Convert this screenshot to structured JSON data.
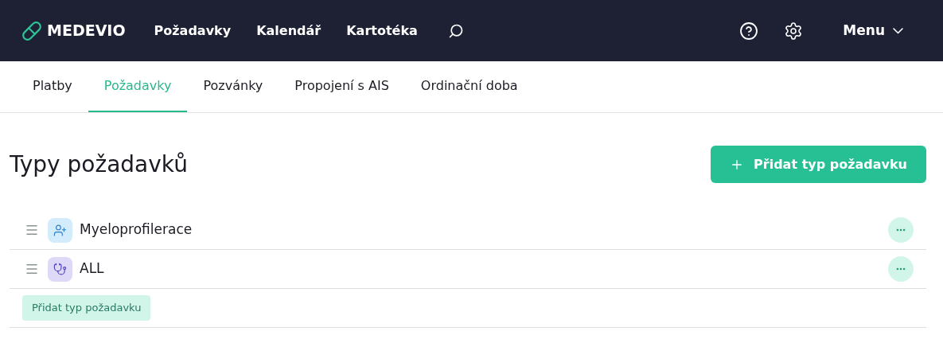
{
  "header": {
    "logo": "MEDEVIO",
    "nav": [
      {
        "label": "Požadavky"
      },
      {
        "label": "Kalendář"
      },
      {
        "label": "Kartotéka"
      }
    ],
    "menu": "Menu"
  },
  "tabs": [
    {
      "label": "Platby",
      "selected": false
    },
    {
      "label": "Požadavky",
      "selected": true
    },
    {
      "label": "Pozvánky",
      "selected": false
    },
    {
      "label": "Propojení s AIS",
      "selected": false
    },
    {
      "label": "Ordinační doba",
      "selected": false
    }
  ],
  "page": {
    "title": "Typy požadavků",
    "add_button": "Přidat typ požadavku"
  },
  "request_types": [
    {
      "name": "Myeloprofilerace",
      "kind": "person-add",
      "color": "#d3ecfb"
    },
    {
      "name": "ALL",
      "kind": "stethoscope",
      "color": "#ddd9f7"
    }
  ],
  "add_link": "Přidat typ požadavku"
}
